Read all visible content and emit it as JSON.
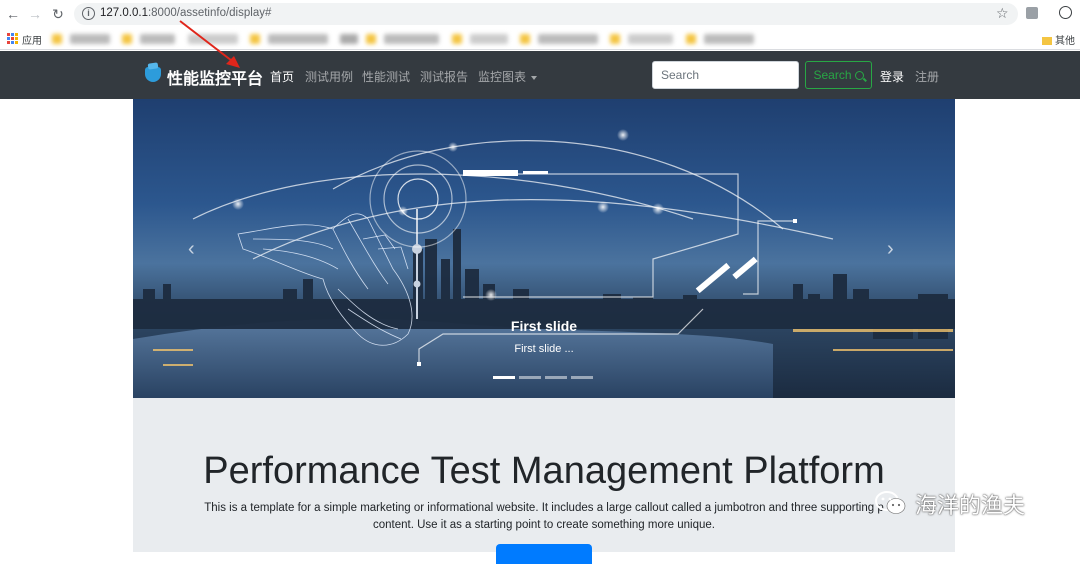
{
  "browser": {
    "url_host": "127.0.0.1",
    "url_rest": ":8000/assetinfo/display#",
    "bookmarks_apps_label": "应用",
    "bookmarks_other_label": "其他"
  },
  "navbar": {
    "brand": "性能监控平台",
    "links": [
      "首页",
      "测试用例",
      "性能测试",
      "测试报告",
      "监控图表"
    ],
    "search_placeholder": "Search",
    "search_button": "Search",
    "login": "登录",
    "register": "注册"
  },
  "carousel": {
    "caption_title": "First slide",
    "caption_text": "First slide ...",
    "indicator_count": 4,
    "active_index": 0
  },
  "jumbotron": {
    "title": "Performance Test Management Platform",
    "lead_line1": "This is a template for a simple marketing or informational website. It includes a large callout called a jumbotron and three supporting p",
    "lead_line2": "content. Use it as a starting point to create something more unique."
  },
  "watermark": {
    "text": "海洋的渔夫"
  },
  "colors": {
    "navbar_bg": "#343a40",
    "search_green": "#28a745",
    "primary_blue": "#007bff",
    "jumbotron_bg": "#e9ecef",
    "annotation_red": "#e0261b"
  }
}
